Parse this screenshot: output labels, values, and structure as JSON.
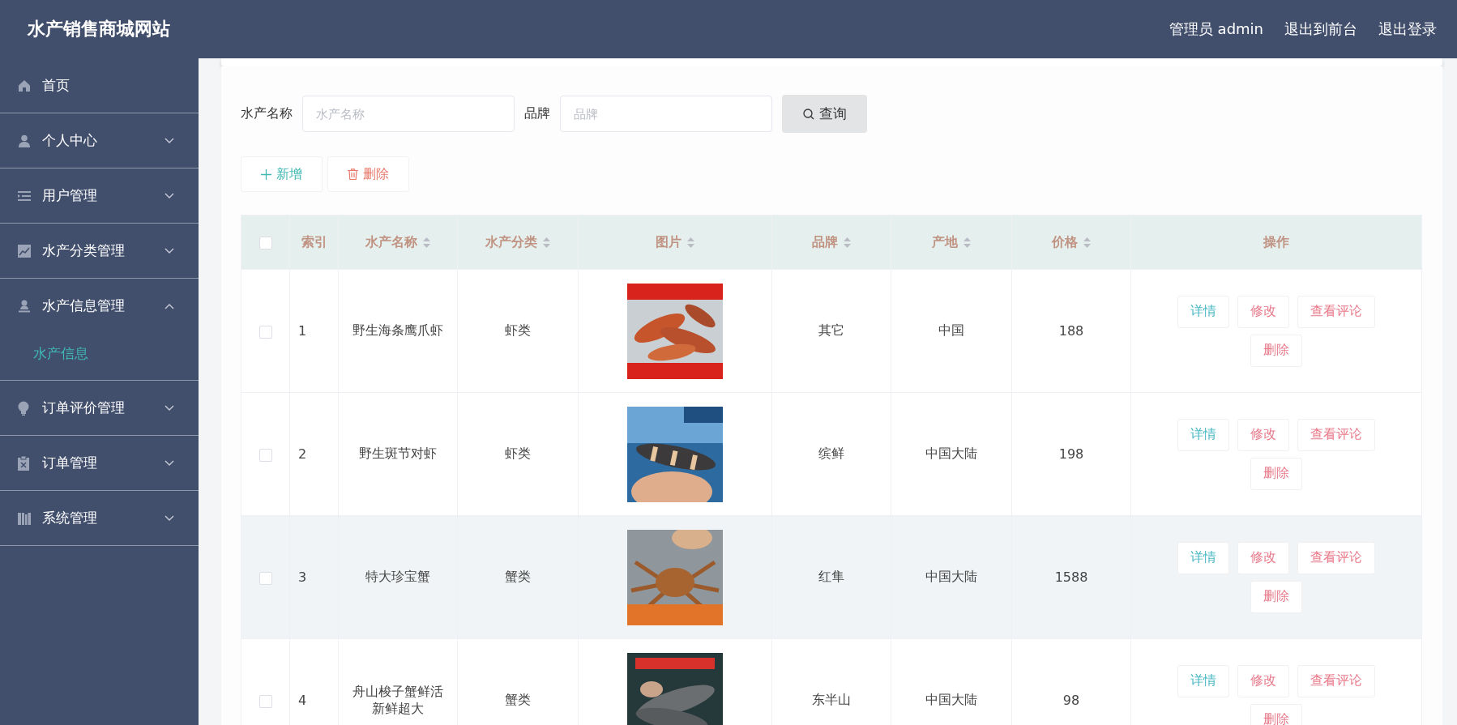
{
  "header": {
    "title": "水产销售商城网站",
    "user": "管理员 admin",
    "links": [
      "退出到前台",
      "退出登录"
    ]
  },
  "sidebar": {
    "items": [
      {
        "label": "首页",
        "kind": "link"
      },
      {
        "label": "个人中心",
        "kind": "group",
        "expanded": false
      },
      {
        "label": "用户管理",
        "kind": "group",
        "expanded": false
      },
      {
        "label": "水产分类管理",
        "kind": "group",
        "expanded": false
      },
      {
        "label": "水产信息管理",
        "kind": "group",
        "expanded": true,
        "children": [
          {
            "label": "水产信息",
            "selected": true
          }
        ]
      },
      {
        "label": "订单评价管理",
        "kind": "group",
        "expanded": false
      },
      {
        "label": "订单管理",
        "kind": "group",
        "expanded": false
      },
      {
        "label": "系统管理",
        "kind": "group",
        "expanded": false
      }
    ]
  },
  "search": {
    "fields": [
      {
        "label": "水产名称",
        "placeholder": "水产名称"
      },
      {
        "label": "品牌",
        "placeholder": "品牌"
      }
    ],
    "button": "查询"
  },
  "actions": [
    {
      "label": "新增",
      "kind": "add"
    },
    {
      "label": "删除",
      "kind": "delete"
    }
  ],
  "table": {
    "select_all": {
      "checked": false
    },
    "columns": [
      {
        "label": "索引",
        "sortable": false
      },
      {
        "label": "水产名称",
        "sortable": true
      },
      {
        "label": "水产分类",
        "sortable": true
      },
      {
        "label": "图片",
        "sortable": true
      },
      {
        "label": "品牌",
        "sortable": true
      },
      {
        "label": "产地",
        "sortable": true
      },
      {
        "label": "价格",
        "sortable": true
      },
      {
        "label": "操作",
        "sortable": false
      }
    ],
    "rows": [
      {
        "checked": false,
        "hovered": false,
        "cells": [
          "1",
          "野生海条鹰爪虾",
          "虾类"
        ],
        "image": {
          "kind": "picture"
        },
        "cells_after": [
          "其它",
          "中国",
          "188"
        ],
        "actions": [
          {
            "label": "详情",
            "kind": "detail"
          },
          {
            "label": "修改",
            "kind": "edit"
          },
          {
            "label": "查看评论",
            "kind": "comments"
          },
          {
            "label": "删除",
            "kind": "delete"
          }
        ]
      },
      {
        "checked": false,
        "hovered": false,
        "cells": [
          "2",
          "野生斑节对虾",
          "虾类"
        ],
        "image": {
          "kind": "picture"
        },
        "cells_after": [
          "缤鲜",
          "中国大陆",
          "198"
        ],
        "actions": [
          {
            "label": "详情",
            "kind": "detail"
          },
          {
            "label": "修改",
            "kind": "edit"
          },
          {
            "label": "查看评论",
            "kind": "comments"
          },
          {
            "label": "删除",
            "kind": "delete"
          }
        ]
      },
      {
        "checked": false,
        "hovered": true,
        "cells": [
          "3",
          "特大珍宝蟹",
          "蟹类"
        ],
        "image": {
          "kind": "picture"
        },
        "cells_after": [
          "红隼",
          "中国大陆",
          "1588"
        ],
        "actions": [
          {
            "label": "详情",
            "kind": "detail"
          },
          {
            "label": "修改",
            "kind": "edit"
          },
          {
            "label": "查看评论",
            "kind": "comments"
          },
          {
            "label": "删除",
            "kind": "delete"
          }
        ]
      },
      {
        "checked": false,
        "hovered": false,
        "cells": [
          "4",
          "舟山梭子蟹鲜活新鲜超大",
          "蟹类"
        ],
        "image": {
          "kind": "picture"
        },
        "cells_after": [
          "东半山",
          "中国大陆",
          "98"
        ],
        "actions": [
          {
            "label": "详情",
            "kind": "detail"
          },
          {
            "label": "修改",
            "kind": "edit"
          },
          {
            "label": "查看评论",
            "kind": "comments"
          },
          {
            "label": "删除",
            "kind": "delete"
          }
        ]
      }
    ]
  }
}
